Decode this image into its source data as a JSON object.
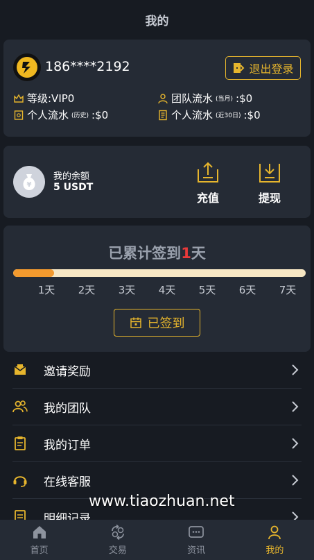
{
  "header": {
    "title": "我的"
  },
  "account": {
    "phone": "186****2192",
    "logout_label": "退出登录",
    "level_label": "等级:VIP0",
    "team_flow_label": "团队流水",
    "team_flow_note": "(当月)",
    "team_flow_value": ":$0",
    "personal_flow_label": "个人流水",
    "personal_flow_note": "(历史)",
    "personal_flow_value": ":$0",
    "personal_flow30_label": "个人流水",
    "personal_flow30_note": "(近30日)",
    "personal_flow30_value": ":$0"
  },
  "balance": {
    "label": "我的余额",
    "value": "5 USDT",
    "recharge_label": "充值",
    "withdraw_label": "提现"
  },
  "signin": {
    "title_prefix": "已累计签到",
    "count": "1",
    "title_suffix": "天",
    "progress": 0.14,
    "days": [
      "1天",
      "2天",
      "3天",
      "4天",
      "5天",
      "6天",
      "7天"
    ],
    "button_label": "已签到"
  },
  "menu": {
    "items": [
      {
        "label": "邀请奖励",
        "icon": "gift-envelope-icon"
      },
      {
        "label": "我的团队",
        "icon": "team-icon"
      },
      {
        "label": "我的订单",
        "icon": "order-icon"
      },
      {
        "label": "在线客服",
        "icon": "headset-icon"
      },
      {
        "label": "明细记录",
        "icon": "record-icon"
      }
    ]
  },
  "watermark": "www.tiaozhuan.net",
  "tabbar": {
    "items": [
      {
        "label": "首页",
        "icon": "home-icon"
      },
      {
        "label": "交易",
        "icon": "exchange-icon"
      },
      {
        "label": "资讯",
        "icon": "news-icon"
      },
      {
        "label": "我的",
        "icon": "user-icon",
        "active": true
      }
    ]
  },
  "colors": {
    "accent": "#e6b52d",
    "background": "#171b22",
    "card": "#252b35",
    "progress": "#f39a2e"
  }
}
